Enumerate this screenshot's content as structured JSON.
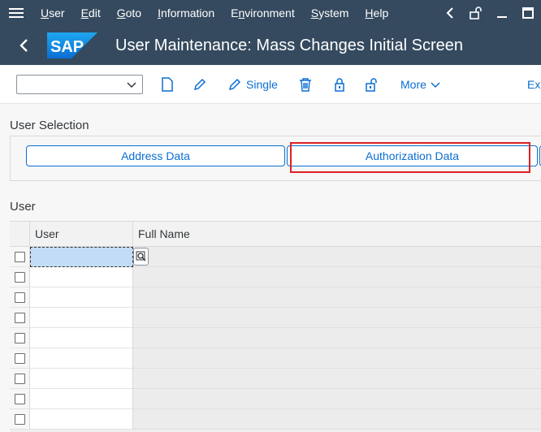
{
  "menu": {
    "items": [
      {
        "label": "User",
        "accel": "U",
        "rest": "ser"
      },
      {
        "label": "Edit",
        "accel": "E",
        "rest": "dit"
      },
      {
        "label": "Goto",
        "accel": "G",
        "rest": "oto"
      },
      {
        "label": "Information",
        "accel": "I",
        "rest": "nformation"
      },
      {
        "label": "Environment",
        "accel": "En",
        "pre": "E",
        "accel2": "n",
        "rest": "vironment"
      },
      {
        "label": "System",
        "accel": "S",
        "rest": "ystem"
      },
      {
        "label": "Help",
        "accel": "H",
        "rest": "elp"
      }
    ]
  },
  "titlebar": {
    "logo_text": "SAP",
    "title": "User Maintenance: Mass Changes Initial Screen"
  },
  "toolbar": {
    "single_label": "Single",
    "more_label": "More",
    "exit_label": "Exi"
  },
  "selection": {
    "title": "User Selection",
    "buttons": [
      "Address Data",
      "Authorization Data"
    ]
  },
  "table": {
    "title": "User",
    "columns": [
      "User",
      "Full Name"
    ],
    "rows": [
      {
        "user": "",
        "full_name": ""
      },
      {
        "user": "",
        "full_name": ""
      },
      {
        "user": "",
        "full_name": ""
      },
      {
        "user": "",
        "full_name": ""
      },
      {
        "user": "",
        "full_name": ""
      },
      {
        "user": "",
        "full_name": ""
      },
      {
        "user": "",
        "full_name": ""
      },
      {
        "user": "",
        "full_name": ""
      },
      {
        "user": "",
        "full_name": ""
      }
    ]
  },
  "colors": {
    "shell": "#354a5f",
    "accent": "#0a6ed1",
    "highlight": "#e02020"
  }
}
